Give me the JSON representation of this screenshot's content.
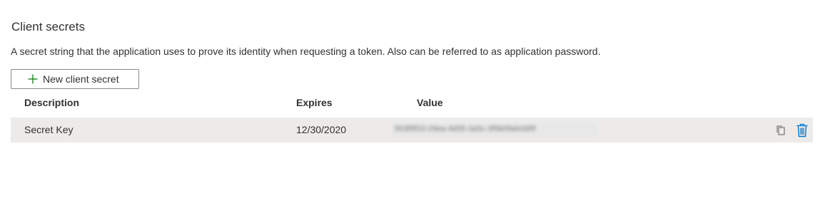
{
  "section": {
    "title": "Client secrets",
    "description": "A secret string that the application uses to prove its identity when requesting a token. Also can be referred to as application password.",
    "new_button": {
      "icon": "plus-icon",
      "label": "New client secret"
    }
  },
  "table": {
    "columns": [
      "Description",
      "Expires",
      "Value"
    ],
    "rows": [
      {
        "description": "Secret Key",
        "expires": "12/30/2020",
        "value": "503f9f23-29ea-4d35-3a5c-3f5b09eb3d5f",
        "value_redacted": true,
        "actions": [
          "copy-icon",
          "delete-icon"
        ]
      }
    ]
  },
  "colors": {
    "accent": "#0078d4",
    "row_background": "#edebe9",
    "text": "#323130",
    "button_border": "#8a8886"
  }
}
